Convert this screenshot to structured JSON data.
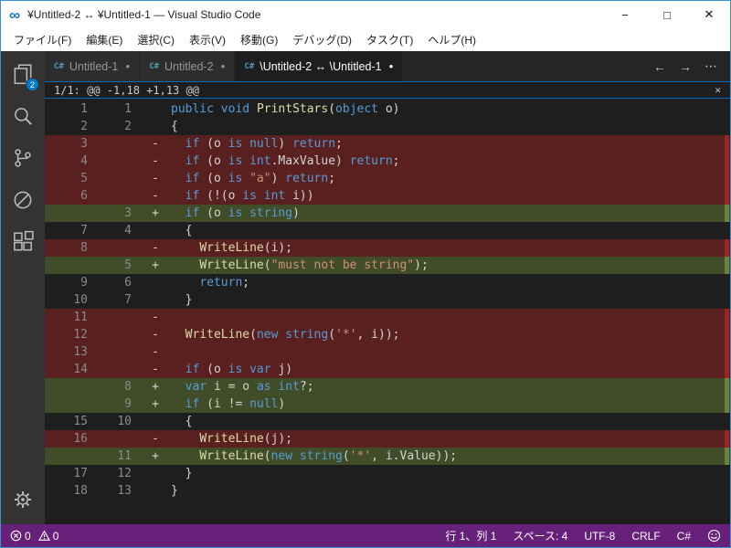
{
  "window": {
    "title": "¥Untitled-2 ↔ ¥Untitled-1 — Visual Studio Code",
    "logo_glyph": "∞",
    "controls": {
      "minimize": "−",
      "maximize": "□",
      "close": "✕"
    }
  },
  "menu_bar": {
    "items": [
      {
        "id": "file",
        "label": "ファイル(F)"
      },
      {
        "id": "edit",
        "label": "編集(E)"
      },
      {
        "id": "selection",
        "label": "選択(C)"
      },
      {
        "id": "view",
        "label": "表示(V)"
      },
      {
        "id": "go",
        "label": "移動(G)"
      },
      {
        "id": "debug",
        "label": "デバッグ(D)"
      },
      {
        "id": "tasks",
        "label": "タスク(T)"
      },
      {
        "id": "help",
        "label": "ヘルプ(H)"
      }
    ]
  },
  "activity_bar": {
    "badge_count": "2",
    "icons": [
      "explorer",
      "search",
      "source-control",
      "debug",
      "extensions",
      "settings"
    ]
  },
  "tab_bar": {
    "file_icon_glyph": "C#",
    "dirty_glyph": "●",
    "tabs": [
      {
        "id": "untitled-1",
        "label": "Untitled-1",
        "active": false
      },
      {
        "id": "untitled-2",
        "label": "Untitled-2",
        "active": false
      },
      {
        "id": "diff-untitled-2-untitled-1",
        "label": "\\Untitled-2 ↔ \\Untitled-1",
        "active": true
      }
    ],
    "actions": [
      {
        "id": "nav-back",
        "glyph": "←"
      },
      {
        "id": "nav-forward",
        "glyph": "→"
      },
      {
        "id": "more-actions",
        "glyph": "⋯"
      }
    ]
  },
  "diff_review": {
    "header": "1/1: @@ -1,18 +1,13 @@",
    "close_glyph": "✕"
  },
  "diff": {
    "lines": [
      {
        "o": "1",
        "n": "1",
        "s": "",
        "t": "same",
        "c": [
          [
            "k",
            "public"
          ],
          [
            "p",
            " "
          ],
          [
            "k",
            "void"
          ],
          [
            "p",
            " "
          ],
          [
            "f",
            "PrintStars"
          ],
          [
            "p",
            "("
          ],
          [
            "k",
            "object"
          ],
          [
            "p",
            " o)"
          ]
        ]
      },
      {
        "o": "2",
        "n": "2",
        "s": "",
        "t": "same",
        "c": [
          [
            "p",
            "{"
          ]
        ]
      },
      {
        "o": "3",
        "n": "",
        "s": "-",
        "t": "del",
        "c": [
          [
            "p",
            "  "
          ],
          [
            "k",
            "if"
          ],
          [
            "p",
            " (o "
          ],
          [
            "k",
            "is"
          ],
          [
            "p",
            " "
          ],
          [
            "k",
            "null"
          ],
          [
            "p",
            ") "
          ],
          [
            "k",
            "return"
          ],
          [
            "p",
            ";"
          ]
        ]
      },
      {
        "o": "4",
        "n": "",
        "s": "-",
        "t": "del",
        "c": [
          [
            "p",
            "  "
          ],
          [
            "k",
            "if"
          ],
          [
            "p",
            " (o "
          ],
          [
            "k",
            "is"
          ],
          [
            "p",
            " "
          ],
          [
            "k",
            "int"
          ],
          [
            "p",
            ".MaxValue) "
          ],
          [
            "k",
            "return"
          ],
          [
            "p",
            ";"
          ]
        ]
      },
      {
        "o": "5",
        "n": "",
        "s": "-",
        "t": "del",
        "c": [
          [
            "p",
            "  "
          ],
          [
            "k",
            "if"
          ],
          [
            "p",
            " (o "
          ],
          [
            "k",
            "is"
          ],
          [
            "p",
            " "
          ],
          [
            "s",
            "\"a\""
          ],
          [
            "p",
            ") "
          ],
          [
            "k",
            "return"
          ],
          [
            "p",
            ";"
          ]
        ]
      },
      {
        "o": "6",
        "n": "",
        "s": "-",
        "t": "del",
        "c": [
          [
            "p",
            "  "
          ],
          [
            "k",
            "if"
          ],
          [
            "p",
            " (!(o "
          ],
          [
            "k",
            "is"
          ],
          [
            "p",
            " "
          ],
          [
            "k",
            "int"
          ],
          [
            "p",
            " i))"
          ]
        ]
      },
      {
        "o": "",
        "n": "3",
        "s": "+",
        "t": "add",
        "c": [
          [
            "p",
            "  "
          ],
          [
            "k",
            "if"
          ],
          [
            "p",
            " (o "
          ],
          [
            "k",
            "is"
          ],
          [
            "p",
            " "
          ],
          [
            "k",
            "string"
          ],
          [
            "p",
            ")"
          ]
        ]
      },
      {
        "o": "7",
        "n": "4",
        "s": "",
        "t": "same",
        "c": [
          [
            "p",
            "  {"
          ]
        ]
      },
      {
        "o": "8",
        "n": "",
        "s": "-",
        "t": "del",
        "c": [
          [
            "p",
            "    "
          ],
          [
            "f",
            "WriteLine"
          ],
          [
            "p",
            "(i);"
          ]
        ]
      },
      {
        "o": "",
        "n": "5",
        "s": "+",
        "t": "add",
        "c": [
          [
            "p",
            "    "
          ],
          [
            "f",
            "WriteLine"
          ],
          [
            "p",
            "("
          ],
          [
            "s",
            "\"must not be string\""
          ],
          [
            "p",
            ");"
          ]
        ]
      },
      {
        "o": "9",
        "n": "6",
        "s": "",
        "t": "same",
        "c": [
          [
            "p",
            "    "
          ],
          [
            "k",
            "return"
          ],
          [
            "p",
            ";"
          ]
        ]
      },
      {
        "o": "10",
        "n": "7",
        "s": "",
        "t": "same",
        "c": [
          [
            "p",
            "  }"
          ]
        ]
      },
      {
        "o": "11",
        "n": "",
        "s": "-",
        "t": "del",
        "c": []
      },
      {
        "o": "12",
        "n": "",
        "s": "-",
        "t": "del",
        "c": [
          [
            "p",
            "  "
          ],
          [
            "f",
            "WriteLine"
          ],
          [
            "p",
            "("
          ],
          [
            "k",
            "new"
          ],
          [
            "p",
            " "
          ],
          [
            "k",
            "string"
          ],
          [
            "p",
            "("
          ],
          [
            "s",
            "'*'"
          ],
          [
            "p",
            ", i));"
          ]
        ]
      },
      {
        "o": "13",
        "n": "",
        "s": "-",
        "t": "del",
        "c": []
      },
      {
        "o": "14",
        "n": "",
        "s": "-",
        "t": "del",
        "c": [
          [
            "p",
            "  "
          ],
          [
            "k",
            "if"
          ],
          [
            "p",
            " (o "
          ],
          [
            "k",
            "is"
          ],
          [
            "p",
            " "
          ],
          [
            "k",
            "var"
          ],
          [
            "p",
            " j)"
          ]
        ]
      },
      {
        "o": "",
        "n": "8",
        "s": "+",
        "t": "add",
        "c": [
          [
            "p",
            "  "
          ],
          [
            "k",
            "var"
          ],
          [
            "p",
            " i = o "
          ],
          [
            "k",
            "as"
          ],
          [
            "p",
            " "
          ],
          [
            "k",
            "int"
          ],
          [
            "p",
            "?;"
          ]
        ]
      },
      {
        "o": "",
        "n": "9",
        "s": "+",
        "t": "add",
        "c": [
          [
            "p",
            "  "
          ],
          [
            "k",
            "if"
          ],
          [
            "p",
            " (i != "
          ],
          [
            "k",
            "null"
          ],
          [
            "p",
            ")"
          ]
        ]
      },
      {
        "o": "15",
        "n": "10",
        "s": "",
        "t": "same",
        "c": [
          [
            "p",
            "  {"
          ]
        ]
      },
      {
        "o": "16",
        "n": "",
        "s": "-",
        "t": "del",
        "c": [
          [
            "p",
            "    "
          ],
          [
            "f",
            "WriteLine"
          ],
          [
            "p",
            "(j);"
          ]
        ]
      },
      {
        "o": "",
        "n": "11",
        "s": "+",
        "t": "add",
        "c": [
          [
            "p",
            "    "
          ],
          [
            "f",
            "WriteLine"
          ],
          [
            "p",
            "("
          ],
          [
            "k",
            "new"
          ],
          [
            "p",
            " "
          ],
          [
            "k",
            "string"
          ],
          [
            "p",
            "("
          ],
          [
            "s",
            "'*'"
          ],
          [
            "p",
            ", i.Value));"
          ]
        ]
      },
      {
        "o": "17",
        "n": "12",
        "s": "",
        "t": "same",
        "c": [
          [
            "p",
            "  }"
          ]
        ]
      },
      {
        "o": "18",
        "n": "13",
        "s": "",
        "t": "same",
        "c": [
          [
            "p",
            "}"
          ]
        ]
      }
    ]
  },
  "status_bar": {
    "errors": "0",
    "warnings": "0",
    "items": [
      {
        "id": "cursor-position",
        "label": "行 1、列 1"
      },
      {
        "id": "indentation",
        "label": "スペース: 4"
      },
      {
        "id": "encoding",
        "label": "UTF-8"
      },
      {
        "id": "eol",
        "label": "CRLF"
      },
      {
        "id": "language-mode",
        "label": "C#"
      }
    ]
  },
  "colors": {
    "accent_blue": "#007acc",
    "frame_border": "#3e8fd0",
    "titlebar_bg": "#ffffff",
    "activitybar_bg": "#333333",
    "editor_bg": "#1e1e1e",
    "tabbar_bg": "#252526",
    "tab_inactive_bg": "#2d2d2d",
    "statusbar_bg": "#68217a",
    "deleted_line_bg": "#5a1f1f",
    "added_line_bg": "#404d28",
    "keyword": "#569cd6",
    "string": "#ce9178",
    "function": "#dcdcaa",
    "text": "#d4d4d4",
    "line_number": "#8a8a8a",
    "csharp_icon_blue": "#519aba"
  }
}
